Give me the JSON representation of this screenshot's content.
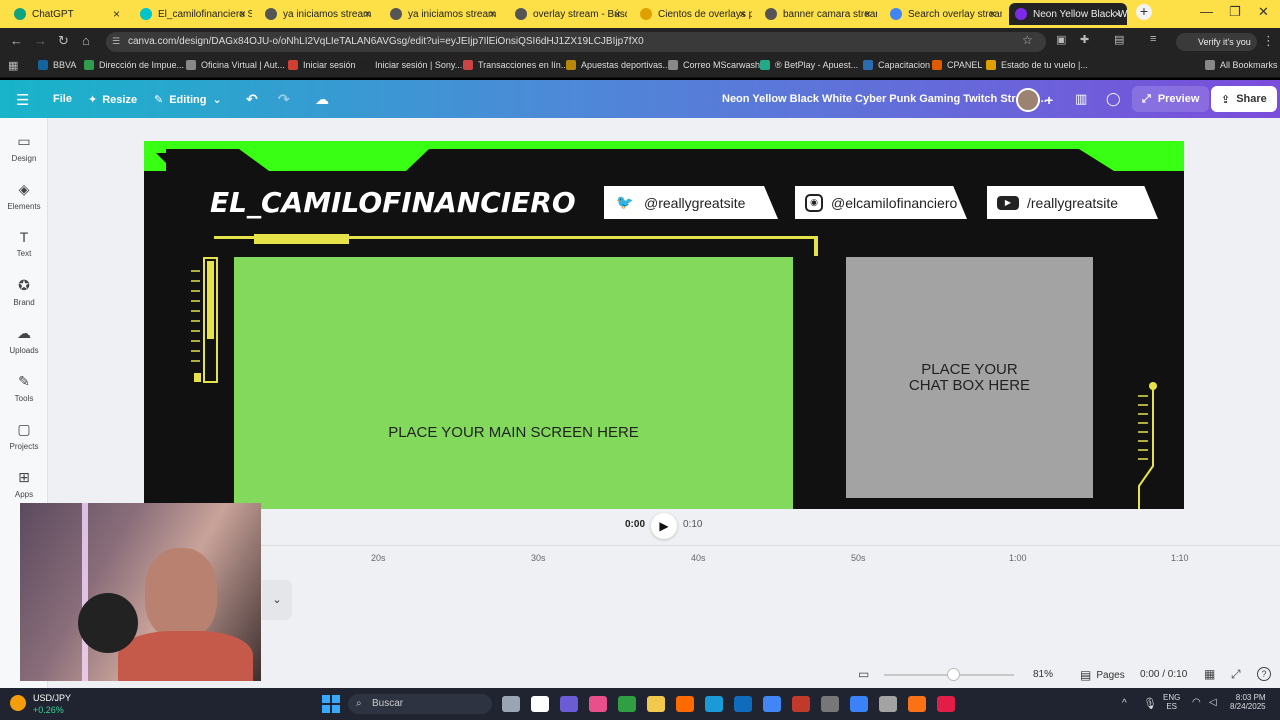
{
  "tabs": [
    {
      "label": "ChatGPT",
      "color": "#10a37f",
      "active": false
    },
    {
      "label": "El_camilofinanciero S",
      "color": "#00c4cc",
      "active": false
    },
    {
      "label": "ya iniciamos stream",
      "color": "#555",
      "active": false
    },
    {
      "label": "ya iniciamos stream",
      "color": "#555",
      "active": false
    },
    {
      "label": "overlay stream - Búsq",
      "color": "#555",
      "active": false
    },
    {
      "label": "Cientos de overlays p",
      "color": "#e0a000",
      "active": false
    },
    {
      "label": "banner camara stream",
      "color": "#555",
      "active": false
    },
    {
      "label": "Search overlay stream",
      "color": "#4285f4",
      "active": false
    },
    {
      "label": "Neon Yellow Black W",
      "color": "#7d2ae8",
      "active": true
    }
  ],
  "address": {
    "url": "canva.com/design/DAGx84OJU-o/oNhLI2VqLIeTALAN6AVGsg/edit?ui=eyJEIjp7IlEiOnsiQSI6dHJ1ZX19LCJBIjp7fX0",
    "profile": "Verify it's you"
  },
  "bookmarks": [
    {
      "label": "BBVA",
      "color": "#1464a0"
    },
    {
      "label": "Dirección de Impue...",
      "color": "#2e9e4e"
    },
    {
      "label": "Oficina Virtual | Aut...",
      "color": "#888"
    },
    {
      "label": "Iniciar sesión",
      "color": "#d04030"
    },
    {
      "label": "Iniciar sesión | Sony...",
      "color": "#222"
    },
    {
      "label": "Transacciones en lín...",
      "color": "#c44"
    },
    {
      "label": "Apuestas deportivas...",
      "color": "#b8860b"
    },
    {
      "label": "Correo MScarwash",
      "color": "#888"
    },
    {
      "label": "® BetPlay - Apuest...",
      "color": "#2a8"
    },
    {
      "label": "Capacitacion",
      "color": "#2b6cb0"
    },
    {
      "label": "CPANEL",
      "color": "#e05a00"
    },
    {
      "label": "Estado de tu vuelo |...",
      "color": "#e0a000"
    },
    {
      "label": "All Bookmarks",
      "color": "#888"
    }
  ],
  "canva_header": {
    "file": "File",
    "resize": "Resize",
    "editing": "Editing",
    "title": "Neon Yellow Black White Cyber Punk Gaming Twitch Stream...",
    "preview": "Preview",
    "share": "Share"
  },
  "sidebar": [
    {
      "label": "Design",
      "icon": "design-icon"
    },
    {
      "label": "Elements",
      "icon": "elements-icon"
    },
    {
      "label": "Text",
      "icon": "text-icon"
    },
    {
      "label": "Brand",
      "icon": "brand-icon"
    },
    {
      "label": "Uploads",
      "icon": "uploads-icon"
    },
    {
      "label": "Tools",
      "icon": "tools-icon"
    },
    {
      "label": "Projects",
      "icon": "projects-icon"
    },
    {
      "label": "Apps",
      "icon": "apps-icon"
    }
  ],
  "design": {
    "channel": "EL_CAMILOFINANCIERO",
    "twitter": "@reallygreatsite",
    "instagram": "@elcamilofinanciero",
    "youtube": "/reallygreatsite",
    "main_screen": "PLACE YOUR MAIN SCREEN HERE",
    "chat_line1": "PLACE YOUR",
    "chat_line2": "CHAT BOX HERE",
    "colors": {
      "neon_green": "#39ff14",
      "yellow": "#e6e34a",
      "screen_green": "#82d95c",
      "chat_gray": "#a3a3a3",
      "bg": "#111111"
    }
  },
  "player": {
    "current": "0:00",
    "duration": "0:10"
  },
  "timeline_ticks": [
    "20s",
    "30s",
    "40s",
    "50s",
    "1:00",
    "1:10"
  ],
  "footer": {
    "zoom": "81%",
    "pages": "Pages",
    "time": "0:00 / 0:10"
  },
  "taskbar": {
    "ticker": "USD/JPY",
    "change": "+0.26%",
    "search": "Buscar",
    "lang1": "ENG",
    "lang2": "ES",
    "time": "8:03 PM",
    "date": "8/24/2025"
  }
}
